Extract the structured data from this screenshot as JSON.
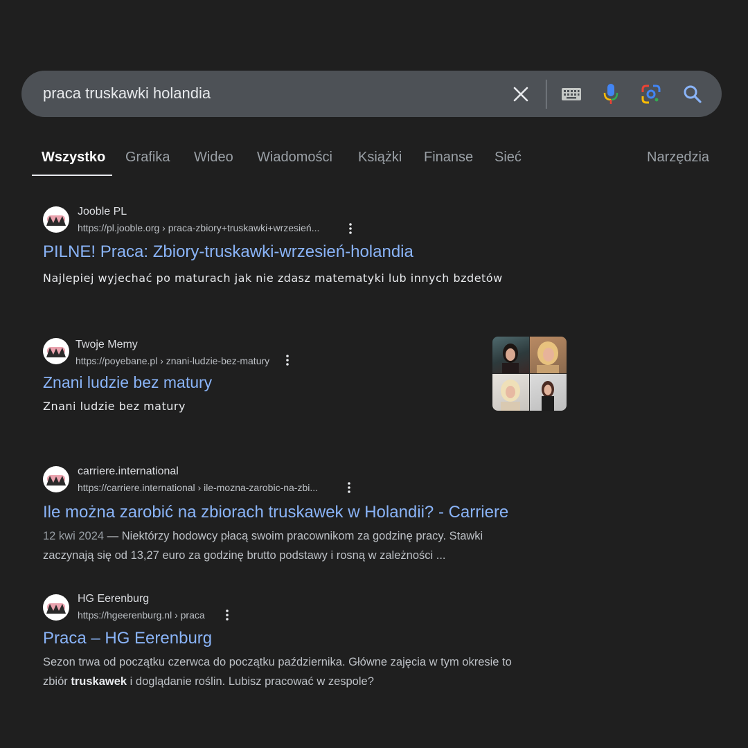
{
  "search": {
    "query": "praca truskawki holandia",
    "clear_icon": "close-icon",
    "keyboard_icon": "keyboard-icon",
    "mic_icon": "microphone-icon",
    "lens_icon": "camera-lens-icon",
    "search_icon": "search-icon"
  },
  "tabs": {
    "items": [
      "Wszystko",
      "Grafika",
      "Wideo",
      "Wiadomości",
      "Książki",
      "Finanse",
      "Sieć"
    ],
    "active": "Wszystko",
    "tools": "Narzędzia"
  },
  "results": [
    {
      "site": "Jooble PL",
      "url": "https://pl.jooble.org › praca-zbiory+truskawki+wrzesień...",
      "title": "PILNE! Praca: Zbiory-truskawki-wrzesień-holandia",
      "snippet": "Najlepiej wyjechać po maturach jak nie zdasz matematyki lub innych bzdetów"
    },
    {
      "site": "Twoje Memy",
      "url": "https://poyebane.pl › znani-ludzie-bez-matury",
      "title": "Znani ludzie bez matury",
      "snippet": "Znani ludzie bez matury"
    },
    {
      "site": "carriere.international",
      "url": "https://carriere.international › ile-mozna-zarobic-na-zbi...",
      "title": "Ile można zarobić na zbiorach truskawek w Holandii? - Carriere",
      "date": "12 kwi 2024",
      "snippet_line1": " — Niektórzy hodowcy płacą swoim pracownikom za godzinę pracy. Stawki",
      "snippet_line2": "zaczynają się od 13,27 euro za godzinę brutto podstawy i rosną w zależności ..."
    },
    {
      "site": "HG Eerenburg",
      "url": "https://hgeerenburg.nl › praca",
      "title": "Praca – HG Eerenburg",
      "snippet_line1": "Sezon trwa od początku czerwca do początku października. Główne zajęcia w tym okresie to",
      "snippet_line2_pre": "zbiór ",
      "snippet_line2_bold": "truskawek",
      "snippet_line2_post": " i doglądanie roślin. Lubisz pracować w zespole?"
    }
  ],
  "colors": {
    "background": "#1f1f1f",
    "searchbar": "#4d5156",
    "link": "#8ab4f8",
    "text": "#e8eaed",
    "muted": "#bdc1c6"
  }
}
